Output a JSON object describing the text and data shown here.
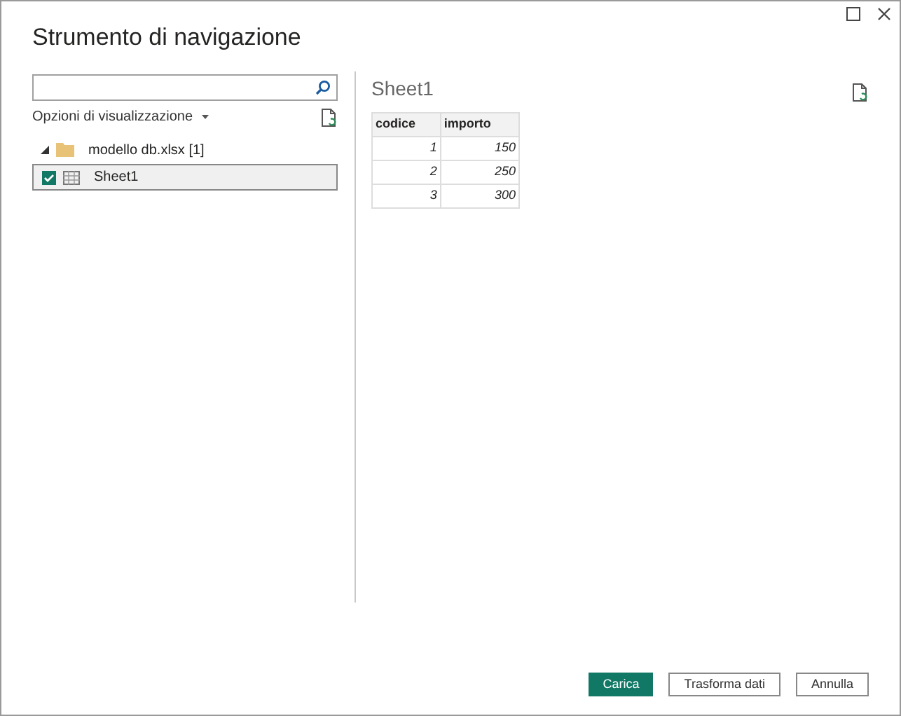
{
  "window": {
    "title": "Strumento di navigazione"
  },
  "view_options": {
    "label": "Opzioni di visualizzazione"
  },
  "tree": [
    {
      "label": "modello db.xlsx [1]",
      "expanded": true,
      "children": [
        {
          "label": "Sheet1",
          "checked": true,
          "selected": true
        }
      ]
    }
  ],
  "preview": {
    "title": "Sheet1",
    "table": {
      "columns": [
        "codice",
        "importo"
      ],
      "rows": [
        [
          "1",
          "150"
        ],
        [
          "2",
          "250"
        ],
        [
          "3",
          "300"
        ]
      ]
    }
  },
  "buttons": [
    {
      "label": "Carica",
      "kind": "primary"
    },
    {
      "label": "Trasforma dati",
      "kind": "secondary"
    },
    {
      "label": "Annulla",
      "kind": "secondary"
    }
  ]
}
